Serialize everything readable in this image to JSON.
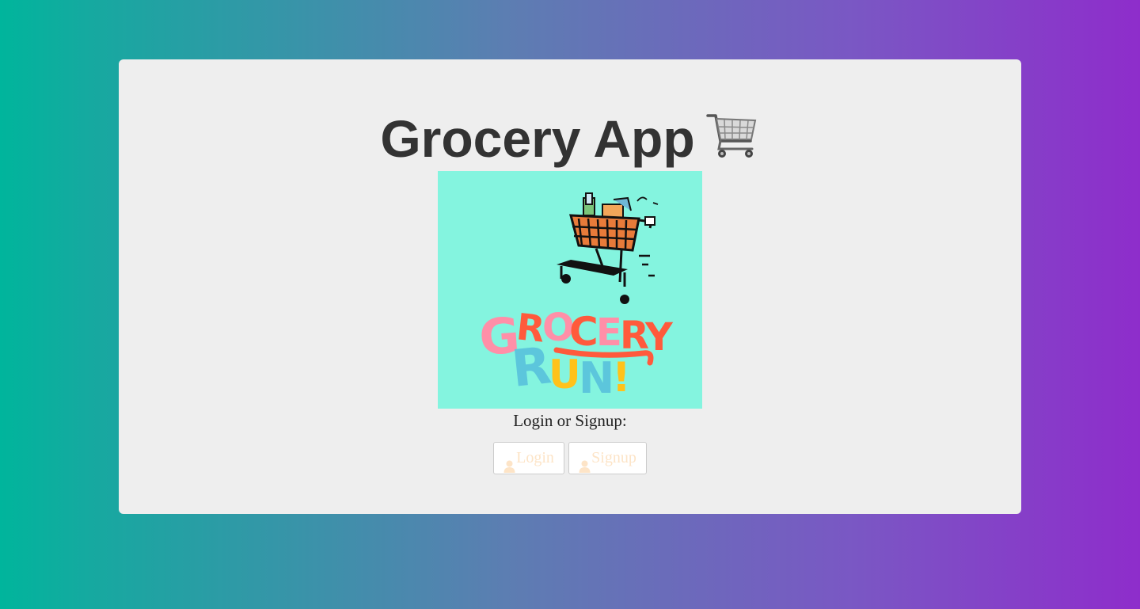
{
  "app": {
    "title": "Grocery App",
    "title_icon": "shopping-cart-icon"
  },
  "hero": {
    "image_name": "grocery-run-illustration",
    "logo_text": "GROCERY RUN!",
    "background": "#84f4df"
  },
  "auth": {
    "prompt": "Login or Signup:",
    "login_label": "Login",
    "signup_label": "Signup",
    "button_icon": "user-icon",
    "label_color": "#fde4c7"
  },
  "colors": {
    "gradient_start": "#00b59c",
    "gradient_end": "#8e2dcb",
    "card_background": "#eeeeee",
    "title_color": "#333333"
  }
}
